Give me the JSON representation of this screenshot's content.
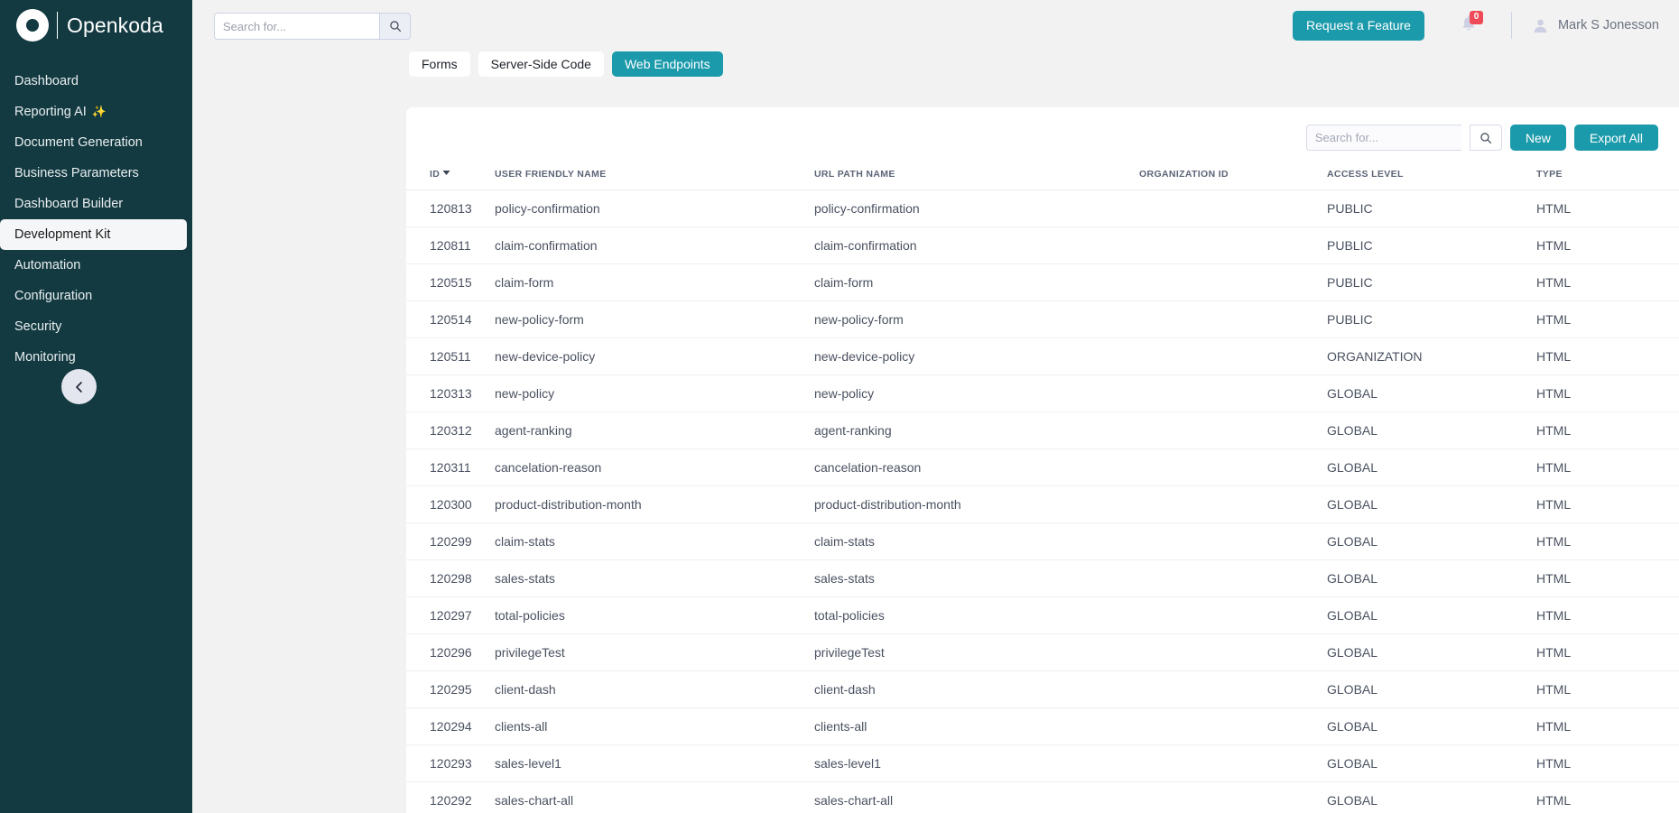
{
  "brand": {
    "name": "Openkoda",
    "logo_icon": "openkoda-ring-logo"
  },
  "sidebar": {
    "items": [
      {
        "label": "Dashboard",
        "active": false
      },
      {
        "label": "Reporting AI",
        "active": false,
        "suffix": "✨"
      },
      {
        "label": "Document Generation",
        "active": false
      },
      {
        "label": "Business Parameters",
        "active": false
      },
      {
        "label": "Dashboard Builder",
        "active": false
      },
      {
        "label": "Development Kit",
        "active": true
      },
      {
        "label": "Automation",
        "active": false
      },
      {
        "label": "Configuration",
        "active": false
      },
      {
        "label": "Security",
        "active": false
      },
      {
        "label": "Monitoring",
        "active": false
      }
    ],
    "collapse_icon": "chevron-left-icon"
  },
  "topbar": {
    "search": {
      "placeholder": "Search for...",
      "value": "",
      "icon": "search-icon"
    },
    "request_feature_label": "Request a Feature",
    "notifications": {
      "icon": "bell-icon",
      "count": "0"
    },
    "user": {
      "name": "Mark S Jonesson",
      "icon": "user-avatar-icon"
    }
  },
  "tabs": [
    {
      "label": "Forms",
      "active": false
    },
    {
      "label": "Server-Side Code",
      "active": false
    },
    {
      "label": "Web Endpoints",
      "active": true
    }
  ],
  "table_toolbar": {
    "search": {
      "placeholder": "Search for...",
      "value": "",
      "icon": "search-icon"
    },
    "new_label": "New",
    "export_all_label": "Export All"
  },
  "table": {
    "columns": [
      "ID",
      "USER FRIENDLY NAME",
      "URL PATH NAME",
      "ORGANIZATION ID",
      "ACCESS LEVEL",
      "TYPE"
    ],
    "sort": {
      "column": "ID",
      "direction": "desc",
      "icon": "caret-down-icon"
    },
    "row_actions": [
      {
        "name": "delete-icon",
        "title": "Delete"
      },
      {
        "name": "download-icon",
        "title": "Download"
      },
      {
        "name": "edit-icon",
        "title": "Edit"
      }
    ],
    "rows": [
      {
        "id": "120813",
        "name": "policy-confirmation",
        "url": "policy-confirmation",
        "org": "",
        "access": "PUBLIC",
        "type": "HTML"
      },
      {
        "id": "120811",
        "name": "claim-confirmation",
        "url": "claim-confirmation",
        "org": "",
        "access": "PUBLIC",
        "type": "HTML"
      },
      {
        "id": "120515",
        "name": "claim-form",
        "url": "claim-form",
        "org": "",
        "access": "PUBLIC",
        "type": "HTML"
      },
      {
        "id": "120514",
        "name": "new-policy-form",
        "url": "new-policy-form",
        "org": "",
        "access": "PUBLIC",
        "type": "HTML"
      },
      {
        "id": "120511",
        "name": "new-device-policy",
        "url": "new-device-policy",
        "org": "",
        "access": "ORGANIZATION",
        "type": "HTML"
      },
      {
        "id": "120313",
        "name": "new-policy",
        "url": "new-policy",
        "org": "",
        "access": "GLOBAL",
        "type": "HTML"
      },
      {
        "id": "120312",
        "name": "agent-ranking",
        "url": "agent-ranking",
        "org": "",
        "access": "GLOBAL",
        "type": "HTML"
      },
      {
        "id": "120311",
        "name": "cancelation-reason",
        "url": "cancelation-reason",
        "org": "",
        "access": "GLOBAL",
        "type": "HTML"
      },
      {
        "id": "120300",
        "name": "product-distribution-month",
        "url": "product-distribution-month",
        "org": "",
        "access": "GLOBAL",
        "type": "HTML"
      },
      {
        "id": "120299",
        "name": "claim-stats",
        "url": "claim-stats",
        "org": "",
        "access": "GLOBAL",
        "type": "HTML"
      },
      {
        "id": "120298",
        "name": "sales-stats",
        "url": "sales-stats",
        "org": "",
        "access": "GLOBAL",
        "type": "HTML"
      },
      {
        "id": "120297",
        "name": "total-policies",
        "url": "total-policies",
        "org": "",
        "access": "GLOBAL",
        "type": "HTML"
      },
      {
        "id": "120296",
        "name": "privilegeTest",
        "url": "privilegeTest",
        "org": "",
        "access": "GLOBAL",
        "type": "HTML"
      },
      {
        "id": "120295",
        "name": "client-dash",
        "url": "client-dash",
        "org": "",
        "access": "GLOBAL",
        "type": "HTML"
      },
      {
        "id": "120294",
        "name": "clients-all",
        "url": "clients-all",
        "org": "",
        "access": "GLOBAL",
        "type": "HTML"
      },
      {
        "id": "120293",
        "name": "sales-level1",
        "url": "sales-level1",
        "org": "",
        "access": "GLOBAL",
        "type": "HTML"
      },
      {
        "id": "120292",
        "name": "sales-chart-all",
        "url": "sales-chart-all",
        "org": "",
        "access": "GLOBAL",
        "type": "HTML"
      }
    ]
  },
  "colors": {
    "sidebar_bg": "#133a41",
    "accent_teal": "#1b9aab",
    "page_bg": "#f2f2f2",
    "danger_red": "#f0454f",
    "badge_red": "#f04a59"
  }
}
